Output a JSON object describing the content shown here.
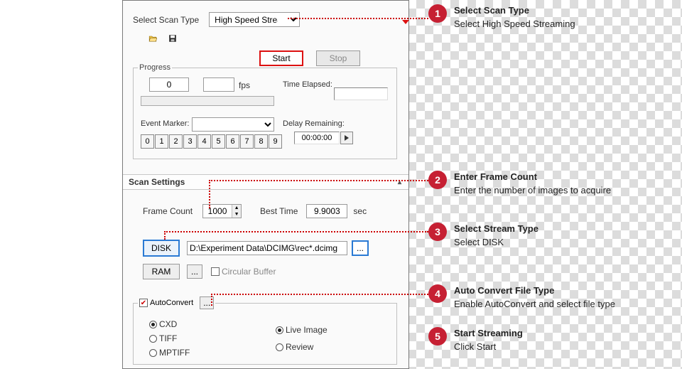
{
  "header": {
    "scan_type_label": "Select Scan Type",
    "scan_type_value": "High Speed Streaming",
    "start_label": "Start",
    "stop_label": "Stop"
  },
  "progress": {
    "legend": "Progress",
    "counter": "0",
    "fps_value": "",
    "fps_label": "fps",
    "time_elapsed_label": "Time Elapsed:",
    "time_elapsed_value": "",
    "event_marker_label": "Event Marker:",
    "event_marker_value": "",
    "markers": [
      "0",
      "1",
      "2",
      "3",
      "4",
      "5",
      "6",
      "7",
      "8",
      "9"
    ],
    "delay_remaining_label": "Delay Remaining:",
    "delay_remaining_value": "00:00:00"
  },
  "scan_settings": {
    "header": "Scan Settings",
    "frame_count_label": "Frame Count",
    "frame_count_value": "1000",
    "best_time_label": "Best Time",
    "best_time_value": "9.9003",
    "best_time_unit": "sec",
    "disk_label": "DISK",
    "path_value": "D:\\Experiment Data\\DCIMG\\rec*.dcimg",
    "browse_label": "...",
    "ram_label": "RAM",
    "ram_browse_label": "...",
    "circular_buffer_label": "Circular Buffer"
  },
  "convert": {
    "autoconvert_label": "AutoConvert",
    "autoconvert_checked": true,
    "dots_label": "...",
    "fmt_cxd": "CXD",
    "fmt_tiff": "TIFF",
    "fmt_mptiff": "MPTIFF",
    "mode_live": "Live Image",
    "mode_review": "Review"
  },
  "callouts": [
    {
      "n": "1",
      "title": "Select Scan Type",
      "body": "Select High Speed Streaming"
    },
    {
      "n": "2",
      "title": "Enter Frame Count",
      "body": "Enter the number of images to acquire"
    },
    {
      "n": "3",
      "title": "Select Stream Type",
      "body": "Select DISK"
    },
    {
      "n": "4",
      "title": "Auto Convert File Type",
      "body": "Enable AutoConvert and select file type"
    },
    {
      "n": "5",
      "title": "Start Streaming",
      "body": "Click Start"
    }
  ]
}
